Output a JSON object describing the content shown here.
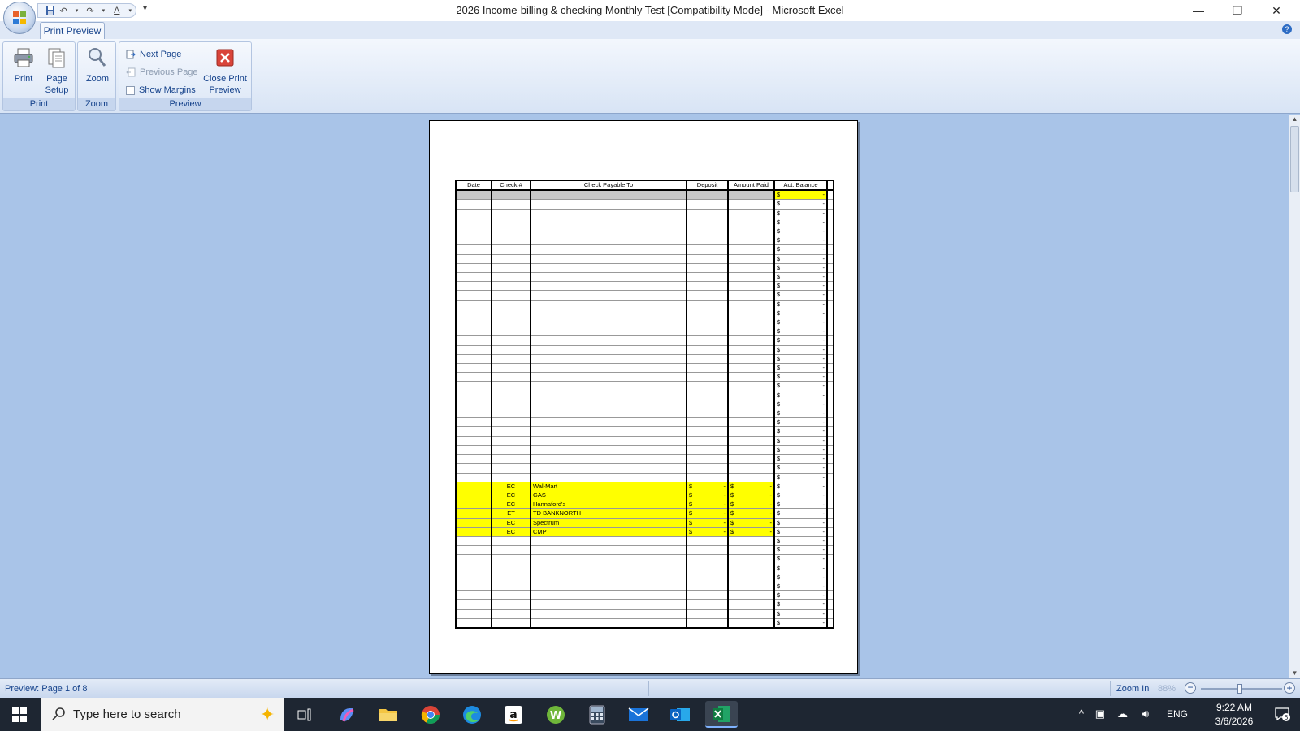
{
  "window": {
    "title": "2026 Income-billing & checking Monthly Test  [Compatibility Mode] - Microsoft Excel",
    "minimize": "—",
    "restore": "❐",
    "close": "✕"
  },
  "ribbon": {
    "tab": "Print Preview",
    "groups": {
      "print": {
        "label": "Print",
        "print_btn": "Print",
        "page_setup_btn_1": "Page",
        "page_setup_btn_2": "Setup"
      },
      "zoom": {
        "label": "Zoom",
        "zoom_btn": "Zoom"
      },
      "preview": {
        "label": "Preview",
        "next_page": "Next Page",
        "previous_page": "Previous Page",
        "show_margins": "Show Margins",
        "close_1": "Close Print",
        "close_2": "Preview"
      }
    }
  },
  "sheet": {
    "headers": [
      "Date",
      "Check #",
      "Check Payable To",
      "Deposit",
      "Amount Paid",
      "Act. Balance"
    ],
    "currency": "$",
    "dash": "-",
    "blank_rows_before": 32,
    "highlighted_rows": [
      {
        "check": "EC",
        "payee": "Wal-Mart"
      },
      {
        "check": "EC",
        "payee": "GAS"
      },
      {
        "check": "EC",
        "payee": "Hannaford's"
      },
      {
        "check": "ET",
        "payee": "TD BANKNORTH"
      },
      {
        "check": "EC",
        "payee": "Spectrum"
      },
      {
        "check": "EC",
        "payee": "CMP"
      }
    ],
    "blank_rows_after": 10
  },
  "status": {
    "text": "Preview: Page 1 of 8",
    "zoom_in": "Zoom In",
    "zoom_pct": "88%",
    "zoom_level": 0.48
  },
  "taskbar": {
    "search_placeholder": "Type here to search",
    "lang": "ENG",
    "time": "9:22 AM",
    "date": "3/6/2026",
    "notifications": "5"
  },
  "colors": {
    "highlight": "#ffff00",
    "ribbon_text": "#15428b",
    "workspace": "#a9c4e8"
  }
}
